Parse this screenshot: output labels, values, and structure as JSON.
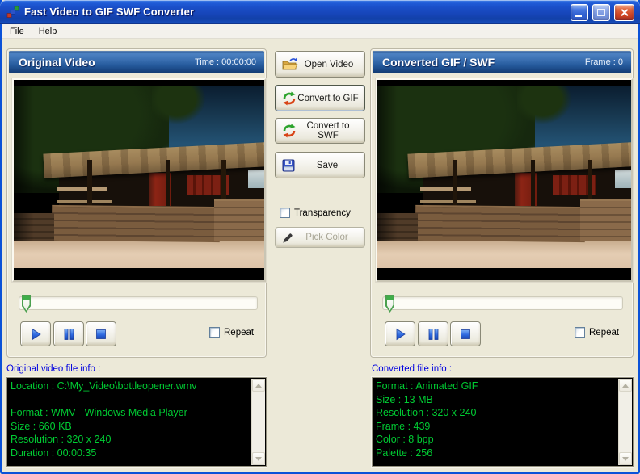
{
  "window": {
    "title": "Fast Video to GIF SWF Converter"
  },
  "menu": {
    "items": [
      {
        "label": "File"
      },
      {
        "label": "Help"
      }
    ]
  },
  "panels": {
    "left": {
      "title": "Original Video",
      "counter": "Time : 00:00:00",
      "repeat_label": "Repeat"
    },
    "right": {
      "title": "Converted GIF / SWF",
      "counter": "Frame : 0",
      "repeat_label": "Repeat"
    }
  },
  "actions": {
    "open_video": "Open Video",
    "convert_gif": "Convert to GIF",
    "convert_swf": "Convert to SWF",
    "save": "Save",
    "transparency": "Transparency",
    "pick_color": "Pick Color"
  },
  "original_info": {
    "label": "Original video file info :",
    "lines": [
      "Location : C:\\My_Video\\bottleopener.wmv",
      "",
      "Format : WMV - Windows Media Player",
      "Size : 660 KB",
      "Resolution : 320 x 240",
      "Duration : 00:00:35"
    ]
  },
  "converted_info": {
    "label": "Converted file info :",
    "lines": [
      "Format : Animated GIF",
      "Size : 13 MB",
      "Resolution : 320 x 240",
      "Frame : 439",
      "Color : 8 bpp",
      "Palette : 256"
    ]
  },
  "colors": {
    "titlebar_blue": "#1746ba",
    "header_blue": "#2f6cb3",
    "window_border_blue": "#0b52d8",
    "background_beige": "#ECE9D8",
    "info_text_green": "#00cc33",
    "info_label_blue": "#0000e0",
    "close_button_red": "#cf4524"
  }
}
